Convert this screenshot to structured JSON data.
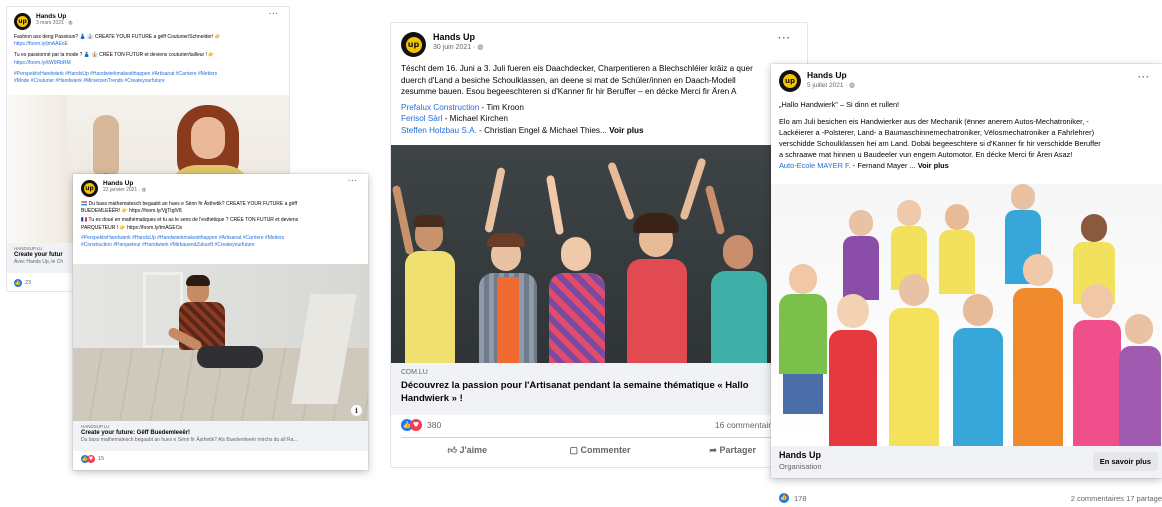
{
  "post1": {
    "page_name": "Hands Up",
    "date": "3 mars 2021 · ",
    "lines": [
      "Fashion ass deng Passioun? 👗 👔 CREATE YOUR FUTURE a gëff Couturier/Schneider! 👉",
      "https://foom.ly/jmAAEoE",
      "Tu es passionné par la mode ? 👗 👔 CRÉE TON FUTUR et deviens couturier/tailleur ! 👉",
      "https://foom.ly/kW9RbRM",
      "#PerspektivHandwierk #HandsUp #Handwierkmakesithappen #Artisanat #Carriere #Metiers",
      "#Mode #Couturier #Handwierk #MirsetzenTrends #Createyourfuture"
    ],
    "source": "HANDSUP.LU",
    "link_title": "Create your futur",
    "link_desc": "Avec Hands Up, le Ch",
    "reactions": "23"
  },
  "post2": {
    "page_name": "Hands Up",
    "date": "22 janvier 2021 · ",
    "lines": [
      "🇱🇺 Du bass mathematesch begaabt an hues e Sënn fir Ästhetik? CREATE YOUR FUTURE a gëff",
      "BUEDEMLEËËR! 👉 https://foom.ly/VjjTtglV8",
      "🇫🇷 Tu es doué en mathématiques et tu as le sens de l'esthétique ? CRÉE TON FUTUR et deviens",
      "PARQUETEUR ! 👉 https://foom.ly/tmAGEOs",
      "#PerspektivHandwierk #HandsUp #Handwierkmakesithappen #Artisanat #Carriere #Metiers",
      "#Construction #Parqueteur #Handwierk #MirbauendZukunft #Createyourfuture"
    ],
    "source": "HANDSUP.LU",
    "link_title": "Create your future: Gëff Buedemleeër!",
    "link_desc": "Du bass mathematesch begaabt an hues e Sënn fir Ästhetik? Als Buedemleeër méchs du all Ra...",
    "reactions": "15"
  },
  "post3": {
    "page_name": "Hands Up",
    "date": "30 juin 2021 · ",
    "text1": "Téscht dem 16. Juni a 3. Juli fueren eis Daachdecker, Charpentieren a Blechschléier kräiz a quer",
    "text2": "duerch d'Land a besiche Schoulklassen, an deene si mat de Schüler/innen en Daach-Modell",
    "text3": "zesumme bauen. Esou begeeschteren si d'Kanner fir hir Beruffer – en décke Merci fir Ären A",
    "mentions": [
      {
        "org": "Prefalux Construction",
        "person": " - Tim Kroon"
      },
      {
        "org": "Ferisol Sàrl",
        "person": " - Michael Kirchen"
      },
      {
        "org": "Steffen Holzbau S.A.",
        "person": " - Christian Engel & Michael Thies..."
      }
    ],
    "see_more": "Voir plus",
    "source": "CDM.LU",
    "link_title": "Découvrez la passion pour l'Artisanat pendant la semaine thématique « Hallo Handwierk » !",
    "reactions": "380",
    "comments": "16 commentaires  66 p",
    "actions": {
      "like": "J'aime",
      "comment": "Commenter",
      "share": "Partager"
    }
  },
  "post4": {
    "page_name": "Hands Up",
    "date": "5 juillet 2021 · ",
    "quote": "„Hallo Handwierk\" – Si dinn et rullen!",
    "text": [
      "Elo am Juli besichen eis Handwierker aus der Mechanik (ënner anerem Autos-Mechatroniker, -",
      "Lackéierer a -Polsterer, Land- a Baumaschinnemechatroniker, Vëlosmechatroniker a Fahrlehrer)",
      "verschidde Schoulklassen hei am Land. Dobäi begeeschtere si d'Kanner fir hir verschidde Beruffer",
      "a schraawe mat hinnen u Baudeeler vun engem Automotor. En décke Merci fir Ären Asaz!"
    ],
    "mention_org": "Auto-Ecole MAYER F.",
    "mention_person": " - Fernand Mayer ... ",
    "see_more": "Voir plus",
    "footer_name": "Hands Up",
    "footer_sub": "Organisation",
    "cta": "En savoir plus",
    "reactions": "178",
    "stats": "2 commentaires  17 partage"
  },
  "colors": {
    "facebook_blue": "#1877f2",
    "link_blue": "#216fdb",
    "brand_yellow": "#f5c400"
  }
}
